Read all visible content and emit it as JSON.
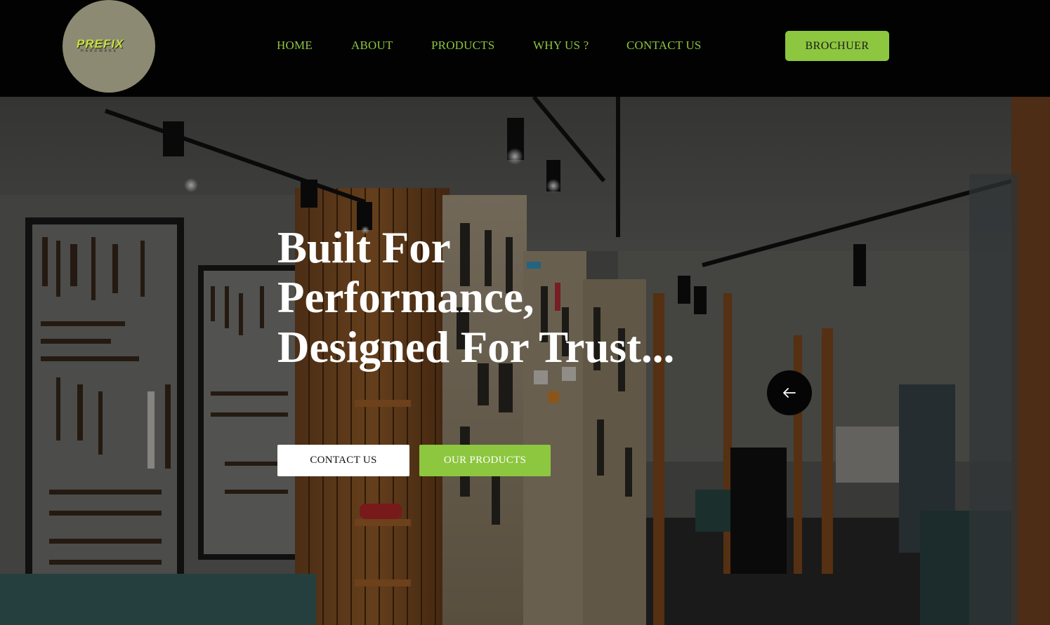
{
  "header": {
    "logo": {
      "text": "PREFIX",
      "subtext": "HARDWARE"
    },
    "nav": [
      {
        "label": "HOME"
      },
      {
        "label": "ABOUT"
      },
      {
        "label": "PRODUCTS"
      },
      {
        "label": "WHY US ?"
      },
      {
        "label": "CONTACT US"
      }
    ],
    "brochure_label": "BROCHUER"
  },
  "hero": {
    "title_lines": [
      "Built For",
      "Performance,",
      "Designed For Trust..."
    ],
    "contact_label": "CONTACT US",
    "products_label": "OUR PRODUCTS",
    "arrow_icon": "arrow-left-icon"
  },
  "colors": {
    "accent": "#8dc63f",
    "header_bg": "#020202",
    "logo_circle": "#8c8a72"
  }
}
